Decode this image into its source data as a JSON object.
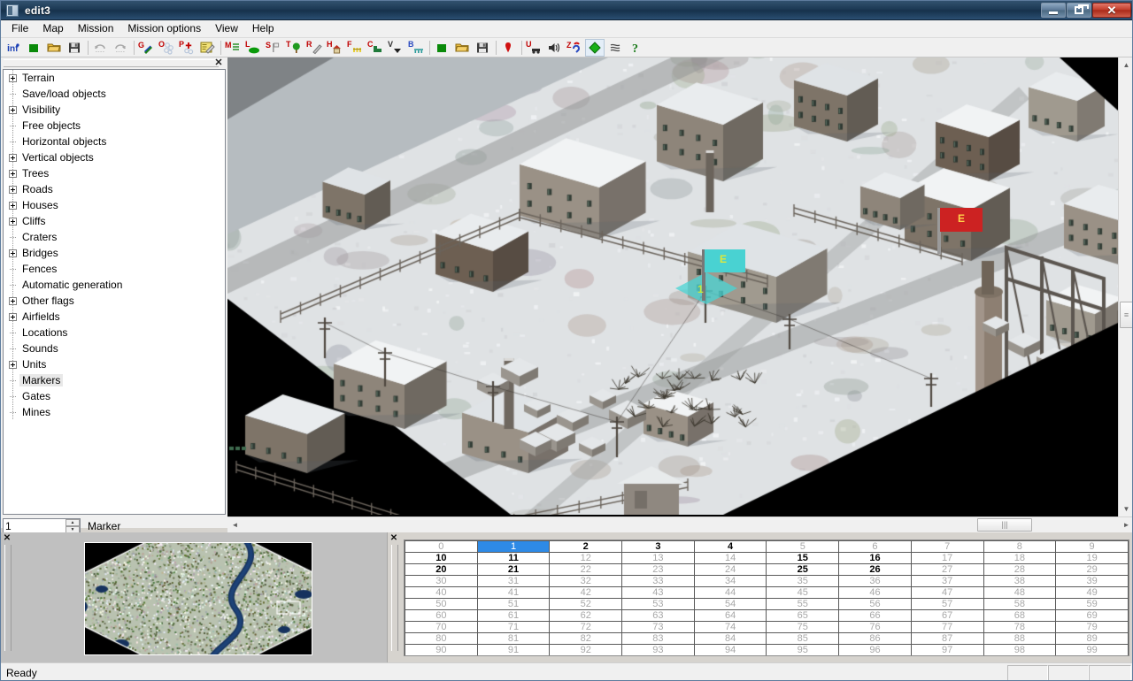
{
  "window": {
    "title": "edit3",
    "icon": "app-icon",
    "minimize_label": "Minimize",
    "maximize_label": "Restore",
    "close_label": "Close"
  },
  "menubar": {
    "items": [
      {
        "label": "File"
      },
      {
        "label": "Map"
      },
      {
        "label": "Mission"
      },
      {
        "label": "Mission options"
      },
      {
        "label": "View"
      },
      {
        "label": "Help"
      }
    ]
  },
  "toolbar": {
    "buttons": [
      {
        "name": "info-button",
        "icon": "info-icon",
        "tip": "Info"
      },
      {
        "name": "new-button",
        "icon": "new-green-square-icon",
        "tip": "New"
      },
      {
        "name": "open-button",
        "icon": "open-folder-icon",
        "tip": "Open"
      },
      {
        "name": "save-button",
        "icon": "floppy-save-icon",
        "tip": "Save"
      },
      {
        "name": "separator-1",
        "icon": "separator",
        "tip": ""
      },
      {
        "name": "undo-button",
        "icon": "undo-arrow-icon",
        "tip": "Undo"
      },
      {
        "name": "redo-button",
        "icon": "redo-arrow-icon",
        "tip": "Redo"
      },
      {
        "name": "separator-2",
        "icon": "separator",
        "tip": ""
      },
      {
        "name": "ground-button",
        "icon": "g-ground-icon",
        "tip": "Ground"
      },
      {
        "name": "objects-button",
        "icon": "o-objects-icon",
        "tip": "Objects"
      },
      {
        "name": "properties-button",
        "icon": "p-properties-icon",
        "tip": "Properties"
      },
      {
        "name": "edit-button",
        "icon": "e-edit-pencil-icon",
        "tip": "Edit"
      },
      {
        "name": "separator-3",
        "icon": "separator",
        "tip": ""
      },
      {
        "name": "mission-button",
        "icon": "m-mission-icon",
        "tip": "Mission"
      },
      {
        "name": "locations-button",
        "icon": "l-locations-icon",
        "tip": "Locations"
      },
      {
        "name": "sounds-flag-button",
        "icon": "s-flag-icon",
        "tip": "Sounds"
      },
      {
        "name": "trees-button",
        "icon": "t-tree-icon",
        "tip": "Trees"
      },
      {
        "name": "roads-button",
        "icon": "r-road-icon",
        "tip": "Roads"
      },
      {
        "name": "houses-button",
        "icon": "h-house-icon",
        "tip": "Houses"
      },
      {
        "name": "fences-button",
        "icon": "f-fence-icon",
        "tip": "Fences"
      },
      {
        "name": "cliffs-button",
        "icon": "c-cliff-icon",
        "tip": "Cliffs"
      },
      {
        "name": "vertical-button",
        "icon": "v-vertical-icon",
        "tip": "Vertical objects"
      },
      {
        "name": "bridges-button",
        "icon": "b-bridge-icon",
        "tip": "Bridges"
      },
      {
        "name": "separator-4",
        "icon": "separator",
        "tip": ""
      },
      {
        "name": "new-mission-button",
        "icon": "new-green-square-icon",
        "tip": "New mission"
      },
      {
        "name": "open-mission-button",
        "icon": "open-folder-icon",
        "tip": "Open mission"
      },
      {
        "name": "save-mission-button",
        "icon": "floppy-save-icon",
        "tip": "Save mission"
      },
      {
        "name": "separator-5",
        "icon": "separator",
        "tip": ""
      },
      {
        "name": "marker-button",
        "icon": "red-marker-pin-icon",
        "tip": "Marker"
      },
      {
        "name": "separator-6",
        "icon": "separator",
        "tip": ""
      },
      {
        "name": "units-button",
        "icon": "u-unit-icon",
        "tip": "Units"
      },
      {
        "name": "sound-button",
        "icon": "speaker-icon",
        "tip": "Sound"
      },
      {
        "name": "zones-button",
        "icon": "z-zones-icon",
        "tip": "Zones"
      },
      {
        "name": "diamond-button",
        "icon": "green-diamond-icon",
        "tip": "Terrain tool",
        "active": true
      },
      {
        "name": "waves-button",
        "icon": "waves-icon",
        "tip": "Water"
      },
      {
        "name": "help-button",
        "icon": "question-help-icon",
        "tip": "Help"
      }
    ]
  },
  "sidebar": {
    "panel_close_label": "✕",
    "tree": [
      {
        "label": "Terrain",
        "expandable": true
      },
      {
        "label": "Save/load objects",
        "expandable": false
      },
      {
        "label": "Visibility",
        "expandable": true
      },
      {
        "label": "Free objects",
        "expandable": false
      },
      {
        "label": "Horizontal objects",
        "expandable": false
      },
      {
        "label": "Vertical objects",
        "expandable": true
      },
      {
        "label": "Trees",
        "expandable": true
      },
      {
        "label": "Roads",
        "expandable": true
      },
      {
        "label": "Houses",
        "expandable": true
      },
      {
        "label": "Cliffs",
        "expandable": true
      },
      {
        "label": "Craters",
        "expandable": false
      },
      {
        "label": "Bridges",
        "expandable": true
      },
      {
        "label": "Fences",
        "expandable": false
      },
      {
        "label": "Automatic generation",
        "expandable": false
      },
      {
        "label": "Other flags",
        "expandable": true
      },
      {
        "label": "Airfields",
        "expandable": true
      },
      {
        "label": "Locations",
        "expandable": false
      },
      {
        "label": "Sounds",
        "expandable": false
      },
      {
        "label": "Units",
        "expandable": true
      },
      {
        "label": "Markers",
        "expandable": false,
        "selected": true
      },
      {
        "label": "Gates",
        "expandable": false
      },
      {
        "label": "Mines",
        "expandable": false
      }
    ],
    "marker_spinner": {
      "value": "1",
      "placeholder": "",
      "label": "Marker",
      "up_glyph": "▲",
      "down_glyph": "▼"
    }
  },
  "map": {
    "flags": [
      {
        "name": "marker-flag-cyan",
        "letter": "E",
        "number": "1",
        "color": "#4ad4d4"
      },
      {
        "name": "marker-flag-red",
        "letter": "E",
        "color": "#cc2222",
        "letter_color": "#ffd24a"
      }
    ],
    "vscroll": {
      "up_glyph": "▲",
      "down_glyph": "▼",
      "grip": "≡"
    },
    "hscroll": {
      "left_glyph": "◄",
      "right_glyph": "►",
      "grip": "|||"
    }
  },
  "minimap": {
    "close_label": "✕",
    "title": "minimap"
  },
  "grid": {
    "close_label": "✕",
    "columns": 10,
    "rows": [
      {
        "cells": [
          "0",
          "1",
          "2",
          "3",
          "4",
          "5",
          "6",
          "7",
          "8",
          "9"
        ],
        "styles": [
          "grey",
          "selected",
          "dark",
          "dark",
          "dark",
          "grey",
          "grey",
          "grey",
          "grey",
          "grey"
        ]
      },
      {
        "cells": [
          "10",
          "11",
          "12",
          "13",
          "14",
          "15",
          "16",
          "17",
          "18",
          "19"
        ],
        "styles": [
          "dark",
          "dark",
          "grey",
          "grey",
          "grey",
          "dark",
          "dark",
          "grey",
          "grey",
          "grey"
        ]
      },
      {
        "cells": [
          "20",
          "21",
          "22",
          "23",
          "24",
          "25",
          "26",
          "27",
          "28",
          "29"
        ],
        "styles": [
          "dark",
          "dark",
          "grey",
          "grey",
          "grey",
          "dark",
          "dark",
          "grey",
          "grey",
          "grey"
        ]
      },
      {
        "cells": [
          "30",
          "31",
          "32",
          "33",
          "34",
          "35",
          "36",
          "37",
          "38",
          "39"
        ],
        "styles": [
          "grey",
          "grey",
          "grey",
          "grey",
          "grey",
          "grey",
          "grey",
          "grey",
          "grey",
          "grey"
        ]
      },
      {
        "cells": [
          "40",
          "41",
          "42",
          "43",
          "44",
          "45",
          "46",
          "47",
          "48",
          "49"
        ],
        "styles": [
          "grey",
          "grey",
          "grey",
          "grey",
          "grey",
          "grey",
          "grey",
          "grey",
          "grey",
          "grey"
        ]
      },
      {
        "cells": [
          "50",
          "51",
          "52",
          "53",
          "54",
          "55",
          "56",
          "57",
          "58",
          "59"
        ],
        "styles": [
          "grey",
          "grey",
          "grey",
          "grey",
          "grey",
          "grey",
          "grey",
          "grey",
          "grey",
          "grey"
        ]
      },
      {
        "cells": [
          "60",
          "61",
          "62",
          "63",
          "64",
          "65",
          "66",
          "67",
          "68",
          "69"
        ],
        "styles": [
          "grey",
          "grey",
          "grey",
          "grey",
          "grey",
          "grey",
          "grey",
          "grey",
          "grey",
          "grey"
        ]
      },
      {
        "cells": [
          "70",
          "71",
          "72",
          "73",
          "74",
          "75",
          "76",
          "77",
          "78",
          "79"
        ],
        "styles": [
          "grey",
          "grey",
          "grey",
          "grey",
          "grey",
          "grey",
          "grey",
          "grey",
          "grey",
          "grey"
        ]
      },
      {
        "cells": [
          "80",
          "81",
          "82",
          "83",
          "84",
          "85",
          "86",
          "87",
          "88",
          "89"
        ],
        "styles": [
          "grey",
          "grey",
          "grey",
          "grey",
          "grey",
          "grey",
          "grey",
          "grey",
          "grey",
          "grey"
        ]
      },
      {
        "cells": [
          "90",
          "91",
          "92",
          "93",
          "94",
          "95",
          "96",
          "97",
          "98",
          "99"
        ],
        "styles": [
          "grey",
          "grey",
          "grey",
          "grey",
          "grey",
          "grey",
          "grey",
          "grey",
          "grey",
          "grey"
        ]
      }
    ]
  },
  "statusbar": {
    "text": "Ready",
    "panes": [
      "",
      "",
      ""
    ]
  },
  "colors": {
    "selection_blue": "#2e8ae6",
    "flag_cyan": "#4ad4d4",
    "flag_red": "#cc2222",
    "title_blue": "#1c3954"
  }
}
